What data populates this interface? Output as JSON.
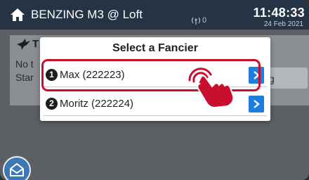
{
  "topbar": {
    "title": "BENZING M3 @ Loft",
    "signal_count": "0",
    "time": "11:48:33",
    "date": "24 Feb 2021"
  },
  "background": {
    "heading_fragment": "T",
    "line1_fragment": "No t",
    "line2_fragment": "Star",
    "button_fragment": "ing"
  },
  "dialog": {
    "title": "Select a Fancier",
    "items": [
      {
        "number": "1",
        "label": "Max (222223)"
      },
      {
        "number": "2",
        "label": "Moritz (222224)"
      }
    ]
  },
  "colors": {
    "topbar": "#243444",
    "accent_blue": "#1e7ee0",
    "highlight_red": "#c8102e"
  },
  "icons": {
    "home": "home-icon",
    "signal": "antenna-icon",
    "pigeon": "pigeon-icon",
    "chevron": "chevron-right-icon",
    "tap": "tap-hand-icon",
    "fab": "envelope-icon"
  }
}
